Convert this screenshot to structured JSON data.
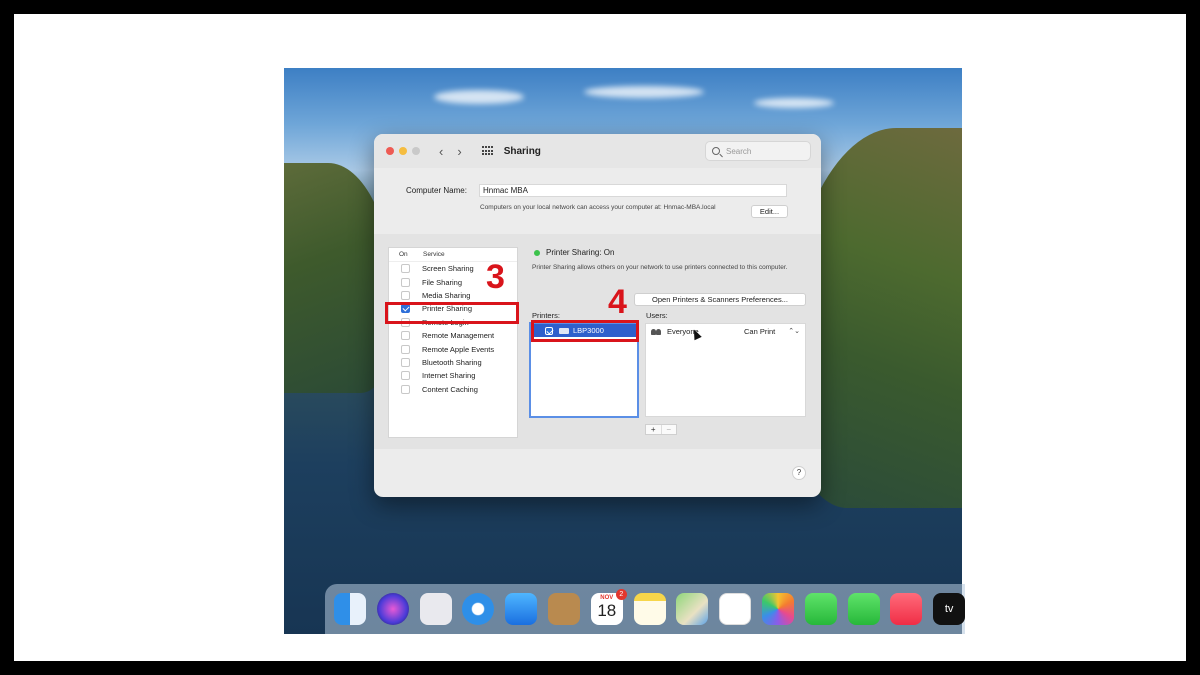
{
  "window": {
    "title": "Sharing",
    "search_placeholder": "Search",
    "back_label": "‹",
    "forward_label": "›"
  },
  "computer_name": {
    "label": "Computer Name:",
    "value": "Hnmac MBA",
    "description": "Computers on your local network can access your computer at: Hnmac-MBA.local",
    "edit_label": "Edit..."
  },
  "services": {
    "header_on": "On",
    "header_service": "Service",
    "items": [
      {
        "label": "Screen Sharing",
        "checked": false
      },
      {
        "label": "File Sharing",
        "checked": false
      },
      {
        "label": "Media Sharing",
        "checked": false
      },
      {
        "label": "Printer Sharing",
        "checked": true
      },
      {
        "label": "Remote Login",
        "checked": false
      },
      {
        "label": "Remote Management",
        "checked": false
      },
      {
        "label": "Remote Apple Events",
        "checked": false
      },
      {
        "label": "Bluetooth Sharing",
        "checked": false
      },
      {
        "label": "Internet Sharing",
        "checked": false
      },
      {
        "label": "Content Caching",
        "checked": false
      }
    ]
  },
  "detail": {
    "status": "Printer Sharing: On",
    "description": "Printer Sharing allows others on your network to use printers connected to this computer.",
    "open_prefs_label": "Open Printers & Scanners Preferences...",
    "printers_label": "Printers:",
    "users_label": "Users:",
    "printers": [
      {
        "name": "LBP3000",
        "checked": true
      }
    ],
    "users": [
      {
        "name": "Everyone",
        "permission": "Can Print"
      }
    ],
    "plus_label": "+",
    "minus_label": "−",
    "stepper_label": "⌃⌄"
  },
  "help_label": "?",
  "callouts": {
    "step3": "3",
    "step4": "4"
  },
  "dock": {
    "calendar_month": "NOV",
    "calendar_day": "18",
    "calendar_badge": "2",
    "tv_label": "tv"
  },
  "colors": {
    "highlight": "#d9141b",
    "accent": "#2e6fd8",
    "status_on": "#3cc24b"
  }
}
